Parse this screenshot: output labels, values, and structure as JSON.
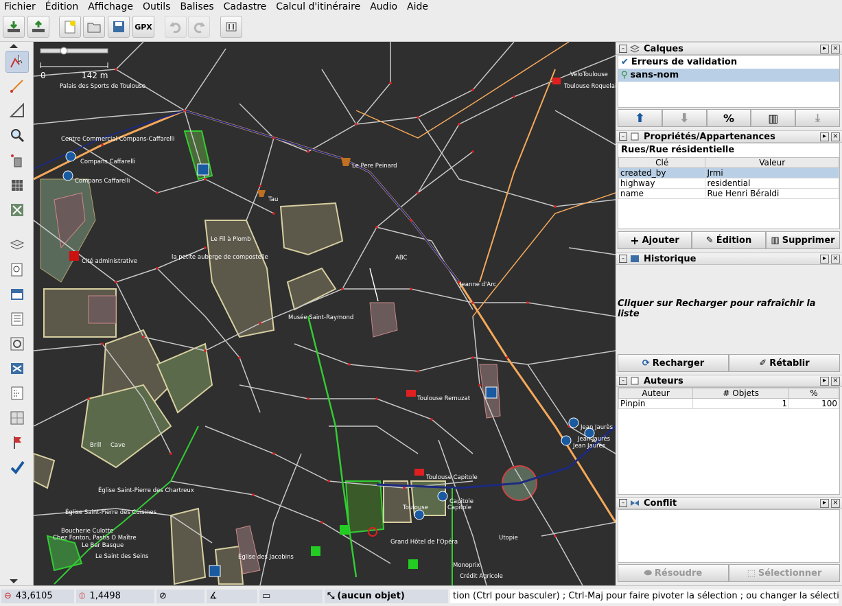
{
  "menu": {
    "items": [
      "Fichier",
      "Édition",
      "Affichage",
      "Outils",
      "Balises",
      "Cadastre",
      "Calcul d'itinéraire",
      "Audio",
      "Aide"
    ]
  },
  "toolbar": {
    "icons": [
      "download-icon",
      "upload-icon",
      "new-layer-icon",
      "open-icon",
      "save-icon",
      "gpx-icon",
      "undo-icon",
      "redo-icon",
      "preferences-icon"
    ],
    "gpx_label": "GPX"
  },
  "tools": {
    "icons": [
      "select-icon",
      "draw-icon",
      "measure-icon",
      "zoom-icon",
      "delete-icon",
      "improve-way-icon",
      "parallel-icon",
      "layers-toggle-icon",
      "search-icon",
      "tag-toggle-icon",
      "selection-list-icon",
      "validation-icon",
      "filter-icon",
      "relations-icon",
      "cadastre-icon",
      "changeset-icon",
      "checkmark-icon"
    ]
  },
  "map": {
    "scale": {
      "left": "0",
      "right": "142 m"
    },
    "labels": [
      "Palais des Sports de Toulouse",
      "VeloToulouse",
      "Toulouse Roquelaine",
      "Centre Commercial Compans-Caffarelli",
      "Compans Caffarelli",
      "Compans Caffarelli",
      "Le Pere Peinard",
      "Tau",
      "Le Fil à Plomb",
      "la petite auberge de compostelle",
      "Cité administrative",
      "ABC",
      "Jeanne d'Arc",
      "Musée Saint-Raymond",
      "Toulouse Remuzat",
      "Jean Jaurès",
      "Jean Jaurès",
      "Jean Jaurès",
      "Toulouse Capitole",
      "Capitole",
      "Toulouse",
      "Capitole",
      "Église Saint-Pierre des Chartreux",
      "Église Saint-Pierre des Cuisines",
      "Boucherie Culotte",
      "Chez Fonton, Pastis O Maître",
      "Le Bar Basque",
      "Le Saint des Seins",
      "Église des Jacobins",
      "Grand Hôtel de l'Opéra",
      "Monoprix",
      "Crédit Agricole",
      "Utopie",
      "Brill",
      "Cave"
    ]
  },
  "panels": {
    "layers": {
      "title": "Calques",
      "items": [
        {
          "name": "Erreurs de validation"
        },
        {
          "name": "sans-nom"
        }
      ]
    },
    "properties": {
      "title": "Propriétés/Appartenances",
      "subtitle": "Rues/Rue résidentielle",
      "col_key": "Clé",
      "col_value": "Valeur",
      "rows": [
        {
          "key": "created_by",
          "value": "Jrmi"
        },
        {
          "key": "highway",
          "value": "residential"
        },
        {
          "key": "name",
          "value": "Rue Henri Béraldi"
        }
      ],
      "btn_add": "Ajouter",
      "btn_edit": "Édition",
      "btn_delete": "Supprimer"
    },
    "history": {
      "title": "Historique",
      "message": "Cliquer sur Recharger pour rafraîchir la liste",
      "btn_reload": "Recharger",
      "btn_restore": "Rétablir"
    },
    "authors": {
      "title": "Auteurs",
      "col_author": "Auteur",
      "col_objects": "# Objets",
      "col_pct": "%",
      "rows": [
        {
          "author": "Pinpin",
          "objects": "1",
          "pct": "100"
        }
      ]
    },
    "conflict": {
      "title": "Conflit",
      "btn_resolve": "Résoudre",
      "btn_select": "Sélectionner"
    }
  },
  "status": {
    "lat": "43,6105",
    "lon": "1,4498",
    "selection": "(aucun objet)",
    "help": "tion (Ctrl pour basculer) ; Ctrl-Maj pour faire pivoter la sélection ; ou changer la sélection"
  },
  "colors": {
    "map_bg": "#2f2f2f",
    "road": "#c8c8c8",
    "major_road": "#f5a85a",
    "node": "#e02020",
    "building": "#d7cfa0",
    "park": "#3a7a3a"
  }
}
